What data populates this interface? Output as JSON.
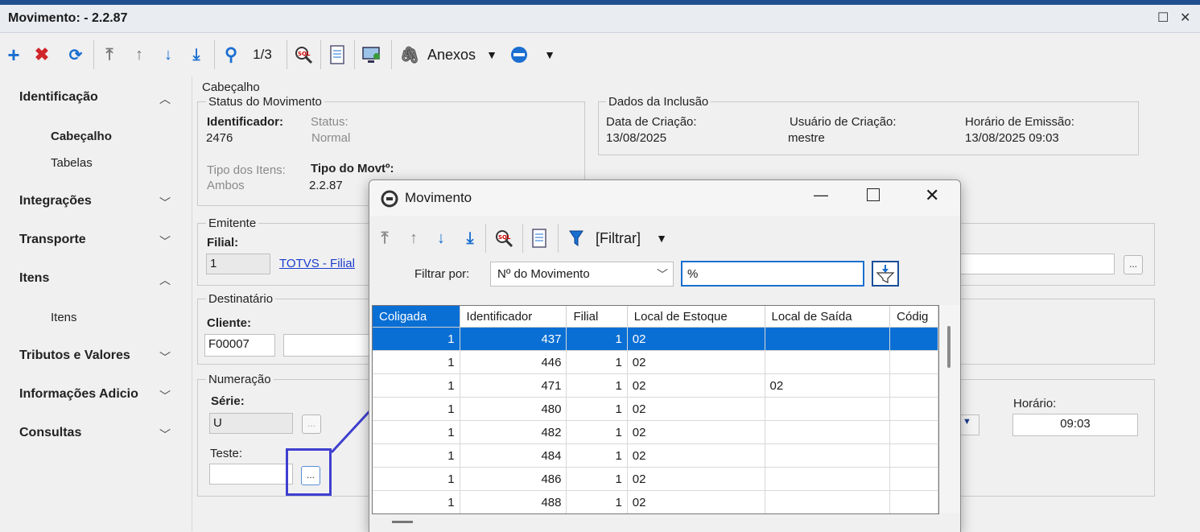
{
  "window": {
    "title": "Movimento:  - 2.2.87"
  },
  "toolbar": {
    "page_counter": "1/3",
    "anexos_label": "Anexos"
  },
  "sidebar": {
    "items": [
      {
        "label": "Identificação"
      },
      {
        "label": "Integrações"
      },
      {
        "label": "Transporte"
      },
      {
        "label": "Itens"
      },
      {
        "label": "Tributos e Valores"
      },
      {
        "label": "Informações Adicio"
      },
      {
        "label": "Consultas"
      }
    ],
    "subitems": {
      "cabecalho": "Cabeçalho",
      "tabelas": "Tabelas",
      "itens": "Itens"
    }
  },
  "form": {
    "cabecalho_label": "Cabeçalho",
    "status_group": "Status do Movimento",
    "identificador_label": "Identificador:",
    "identificador_value": "2476",
    "status_label": "Status:",
    "status_value": "Normal",
    "tipo_itens_label": "Tipo dos Itens:",
    "tipo_itens_value": "Ambos",
    "tipo_movto_label": "Tipo do Movtº:",
    "tipo_movto_value": "2.2.87",
    "dados_group": "Dados da Inclusão",
    "data_criacao_label": "Data de Criação:",
    "data_criacao_value": "13/08/2025",
    "usuario_label": "Usuário de Criação:",
    "usuario_value": "mestre",
    "horario_emissao_label": "Horário de Emissão:",
    "horario_emissao_value": "13/08/2025 09:03",
    "emitente_group": "Emitente",
    "filial_label": "Filial:",
    "filial_value": "1",
    "filial_link": "TOTVS - Filial",
    "destinatario_group": "Destinatário",
    "cliente_label": "Cliente:",
    "cliente_value": "F00007",
    "numeracao_group": "Numeração",
    "serie_label": "Série:",
    "serie_value": "U",
    "teste_label": "Teste:",
    "horario_label": "Horário:",
    "horario_value": "09:03",
    "dots": "..."
  },
  "dialog": {
    "title": "Movimento",
    "filter_label": "[Filtrar]",
    "filtrar_por_label": "Filtrar por:",
    "filtrar_por_value": "Nº do Movimento",
    "filter_input_value": "%",
    "columns": [
      "Coligada",
      "Identificador",
      "Filial",
      "Local de Estoque",
      "Local de Saída",
      "Códig"
    ],
    "rows": [
      {
        "coligada": "1",
        "identificador": "437",
        "filial": "1",
        "local_estoque": "02",
        "local_saida": "",
        "selected": true
      },
      {
        "coligada": "1",
        "identificador": "446",
        "filial": "1",
        "local_estoque": "02",
        "local_saida": ""
      },
      {
        "coligada": "1",
        "identificador": "471",
        "filial": "1",
        "local_estoque": "02",
        "local_saida": "02"
      },
      {
        "coligada": "1",
        "identificador": "480",
        "filial": "1",
        "local_estoque": "02",
        "local_saida": ""
      },
      {
        "coligada": "1",
        "identificador": "482",
        "filial": "1",
        "local_estoque": "02",
        "local_saida": ""
      },
      {
        "coligada": "1",
        "identificador": "484",
        "filial": "1",
        "local_estoque": "02",
        "local_saida": ""
      },
      {
        "coligada": "1",
        "identificador": "486",
        "filial": "1",
        "local_estoque": "02",
        "local_saida": ""
      },
      {
        "coligada": "1",
        "identificador": "488",
        "filial": "1",
        "local_estoque": "02",
        "local_saida": ""
      }
    ]
  },
  "colors": {
    "selection": "#0a6fd4",
    "highlight": "#3f3fd0",
    "link": "#1a3ccc"
  }
}
